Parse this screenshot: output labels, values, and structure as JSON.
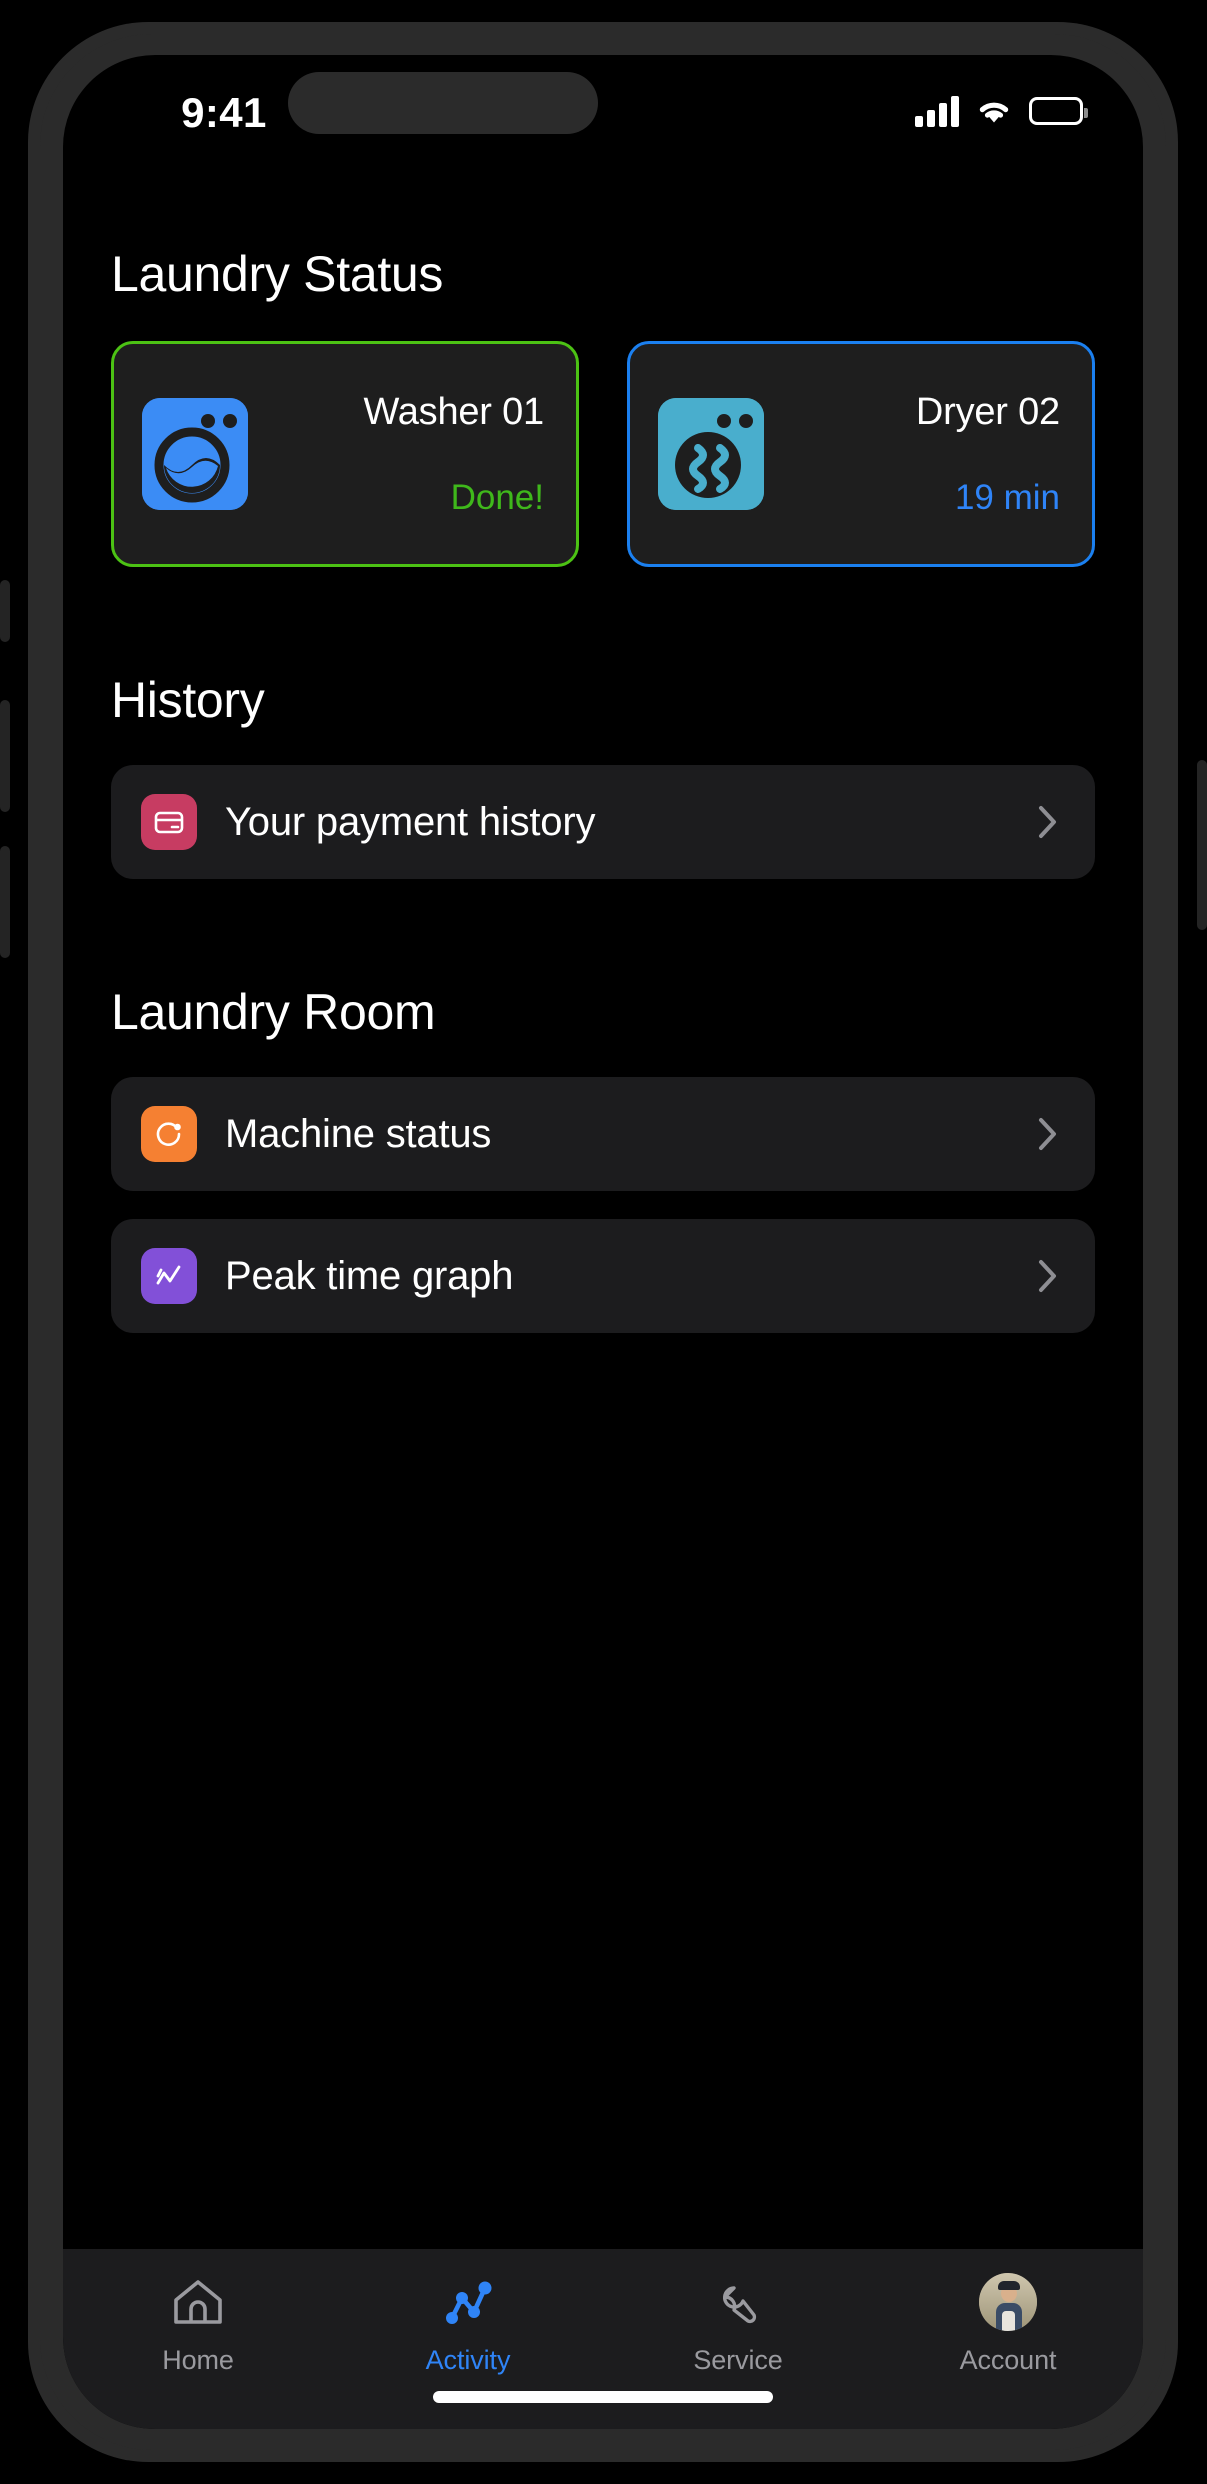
{
  "status_bar": {
    "time": "9:41",
    "cellular_icon": "cellular-bars-icon",
    "wifi_icon": "wifi-icon",
    "battery_icon": "battery-icon"
  },
  "sections": {
    "laundry_status": {
      "title": "Laundry Status",
      "machines": [
        {
          "name": "Washer 01",
          "status": "Done!",
          "state": "done",
          "icon": "washer-icon",
          "icon_color": "#3b8cf5",
          "border_color": "#4cc214",
          "status_color": "#3fb81b"
        },
        {
          "name": "Dryer 02",
          "status": "19 min",
          "state": "running",
          "icon": "dryer-icon",
          "icon_color": "#49aecd",
          "border_color": "#1b80f0",
          "status_color": "#2f84f7"
        }
      ]
    },
    "history": {
      "title": "History",
      "rows": [
        {
          "label": "Your payment history",
          "icon": "credit-card-icon",
          "icon_color": "#c73c62",
          "chevron": "chevron-right-icon"
        }
      ]
    },
    "laundry_room": {
      "title": "Laundry Room",
      "rows": [
        {
          "label": "Machine status",
          "icon": "refresh-circle-icon",
          "icon_color": "#f58032",
          "chevron": "chevron-right-icon"
        },
        {
          "label": "Peak time graph",
          "icon": "line-chart-icon",
          "icon_color": "#8250d8",
          "chevron": "chevron-right-icon"
        }
      ]
    }
  },
  "tab_bar": {
    "active_tab": "Activity",
    "tabs": [
      {
        "label": "Home",
        "icon": "home-icon",
        "active": false
      },
      {
        "label": "Activity",
        "icon": "activity-icon",
        "active": true
      },
      {
        "label": "Service",
        "icon": "wrench-icon",
        "active": false
      },
      {
        "label": "Account",
        "icon": "avatar-icon",
        "active": false
      }
    ]
  }
}
